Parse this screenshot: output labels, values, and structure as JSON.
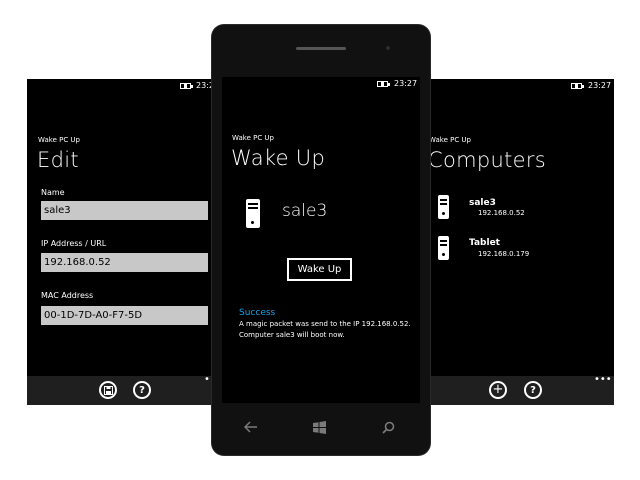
{
  "status": {
    "time_left": "23:2",
    "time_center": "23:27",
    "time_right": "23:27"
  },
  "app_name": "Wake PC Up",
  "edit_screen": {
    "title": "Edit",
    "name_label": "Name",
    "name_value": "sale3",
    "ip_label": "IP Address / URL",
    "ip_value": "192.168.0.52",
    "mac_label": "MAC Address",
    "mac_value": "00-1D-7D-A0-F7-5D",
    "appbar": {
      "save_icon": "save-icon",
      "help_icon": "help-icon",
      "more": "•••"
    }
  },
  "wake_screen": {
    "title": "Wake Up",
    "computer_name": "sale3",
    "button_label": "Wake Up",
    "status_title": "Success",
    "status_line1": "A magic packet was send to the IP 192.168.0.52.",
    "status_line2": "Computer sale3 will boot now."
  },
  "computers_screen": {
    "title": "Computers",
    "items": [
      {
        "name": "sale3",
        "ip": "192.168.0.52"
      },
      {
        "name": "Tablet",
        "ip": "192.168.0.179"
      }
    ],
    "appbar": {
      "add_icon": "add-icon",
      "help_icon": "help-icon",
      "more": "•••"
    }
  },
  "nav": {
    "back": "back-arrow-icon",
    "start": "windows-icon",
    "search": "search-icon"
  },
  "colors": {
    "accent": "#1ba1e2",
    "screen_bg": "#000000",
    "field_bg": "#c8c8c8",
    "appbar_bg": "#1f1f1f"
  }
}
